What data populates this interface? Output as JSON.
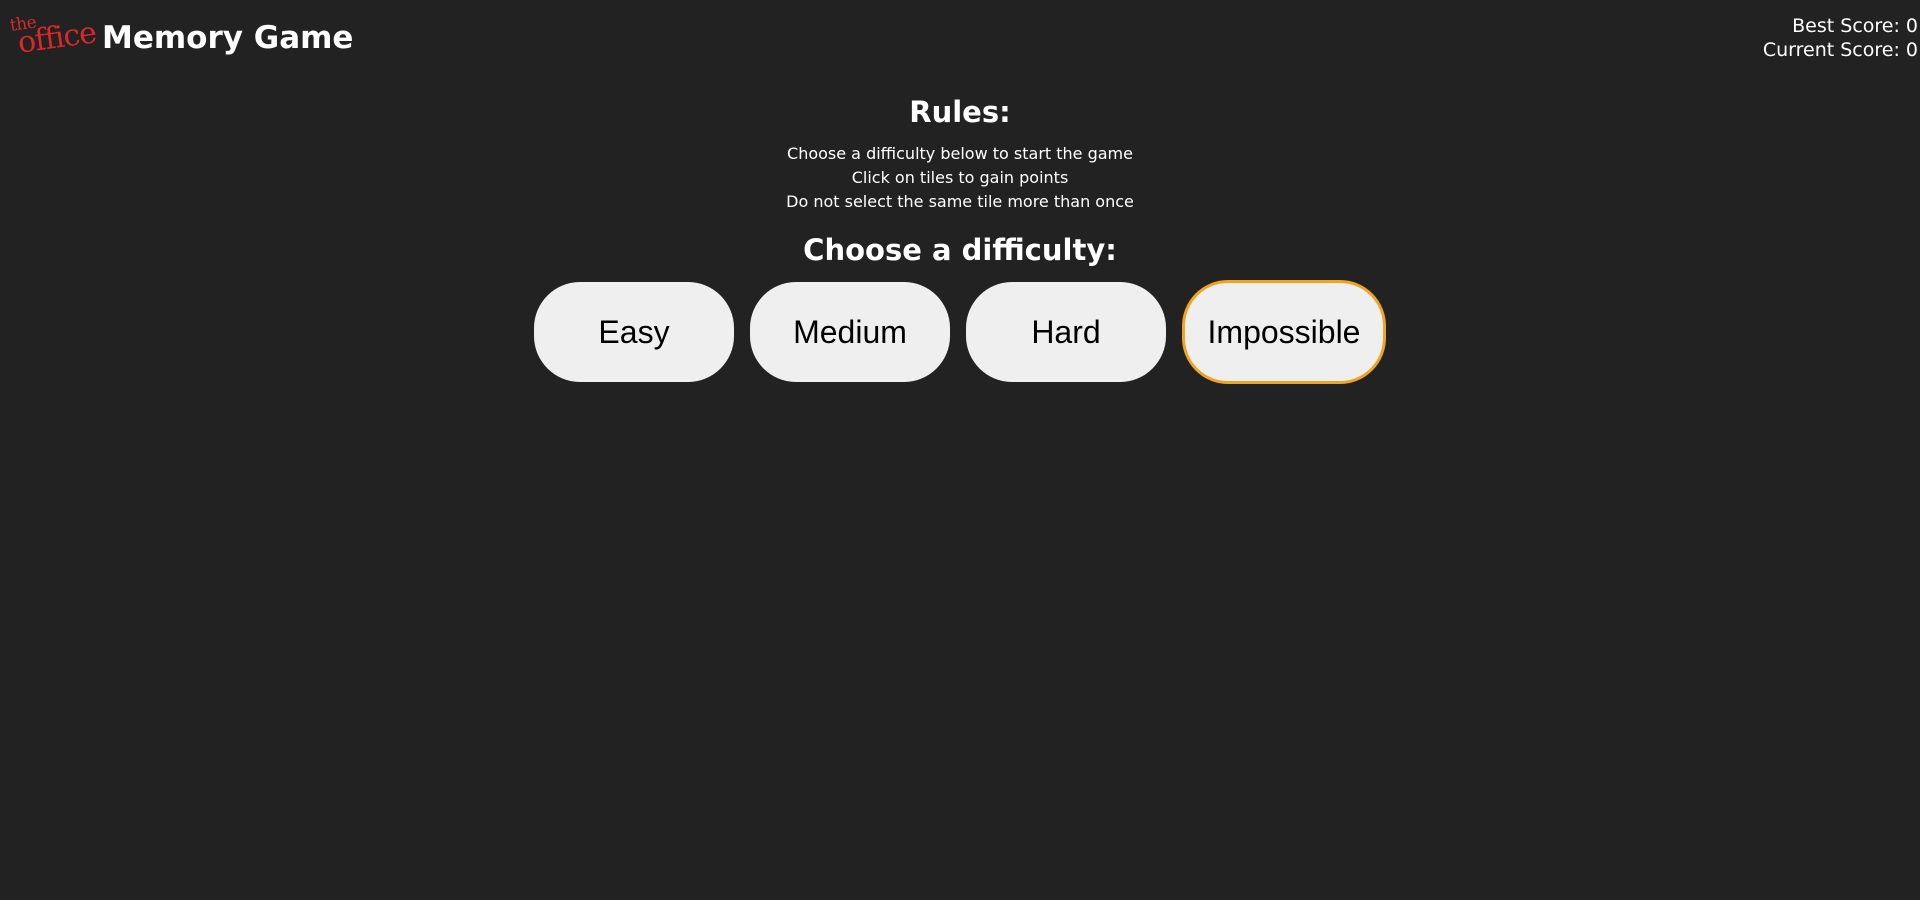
{
  "header": {
    "logo": {
      "the": "the",
      "office": "office"
    },
    "title": "Memory Game",
    "best_score": "Best Score: 0",
    "current_score": "Current Score: 0"
  },
  "rules": {
    "title": "Rules:",
    "items": [
      "Choose a difficulty below to start the game",
      "Click on tiles to gain points",
      "Do not select the same tile more than once"
    ]
  },
  "difficulty": {
    "title": "Choose a difficulty:",
    "buttons": [
      "Easy",
      "Medium",
      "Hard",
      "Impossible"
    ],
    "focused": "Impossible"
  },
  "colors": {
    "background": "#222222",
    "logo_red": "#d8282b",
    "button_bg": "#efefef",
    "focus_outline": "#f0a423"
  }
}
